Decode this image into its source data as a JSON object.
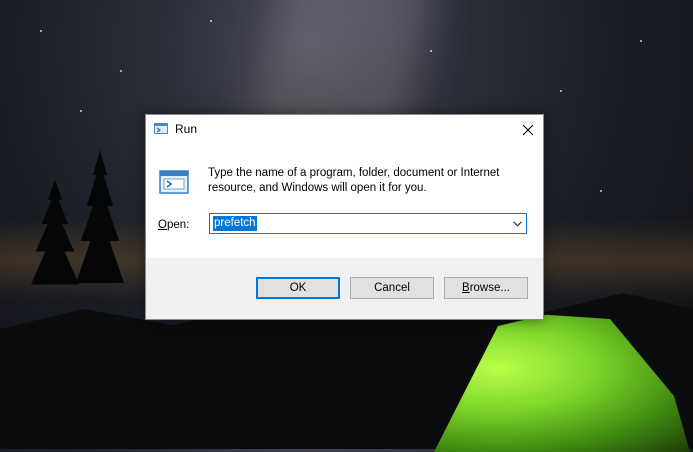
{
  "dialog": {
    "title": "Run",
    "description": "Type the name of a program, folder, document or Internet resource, and Windows will open it for you.",
    "open_label_prefix": "",
    "open_label_mnemonic": "O",
    "open_label_rest": "pen:",
    "open_value": "prefetch",
    "ok_label": "OK",
    "cancel_label": "Cancel",
    "browse_label_mnemonic": "B",
    "browse_label_rest": "rowse...",
    "close_icon": "close-icon",
    "run_icon": "run-icon",
    "dropdown_icon": "chevron-down-icon",
    "accent_color": "#0078d7"
  }
}
